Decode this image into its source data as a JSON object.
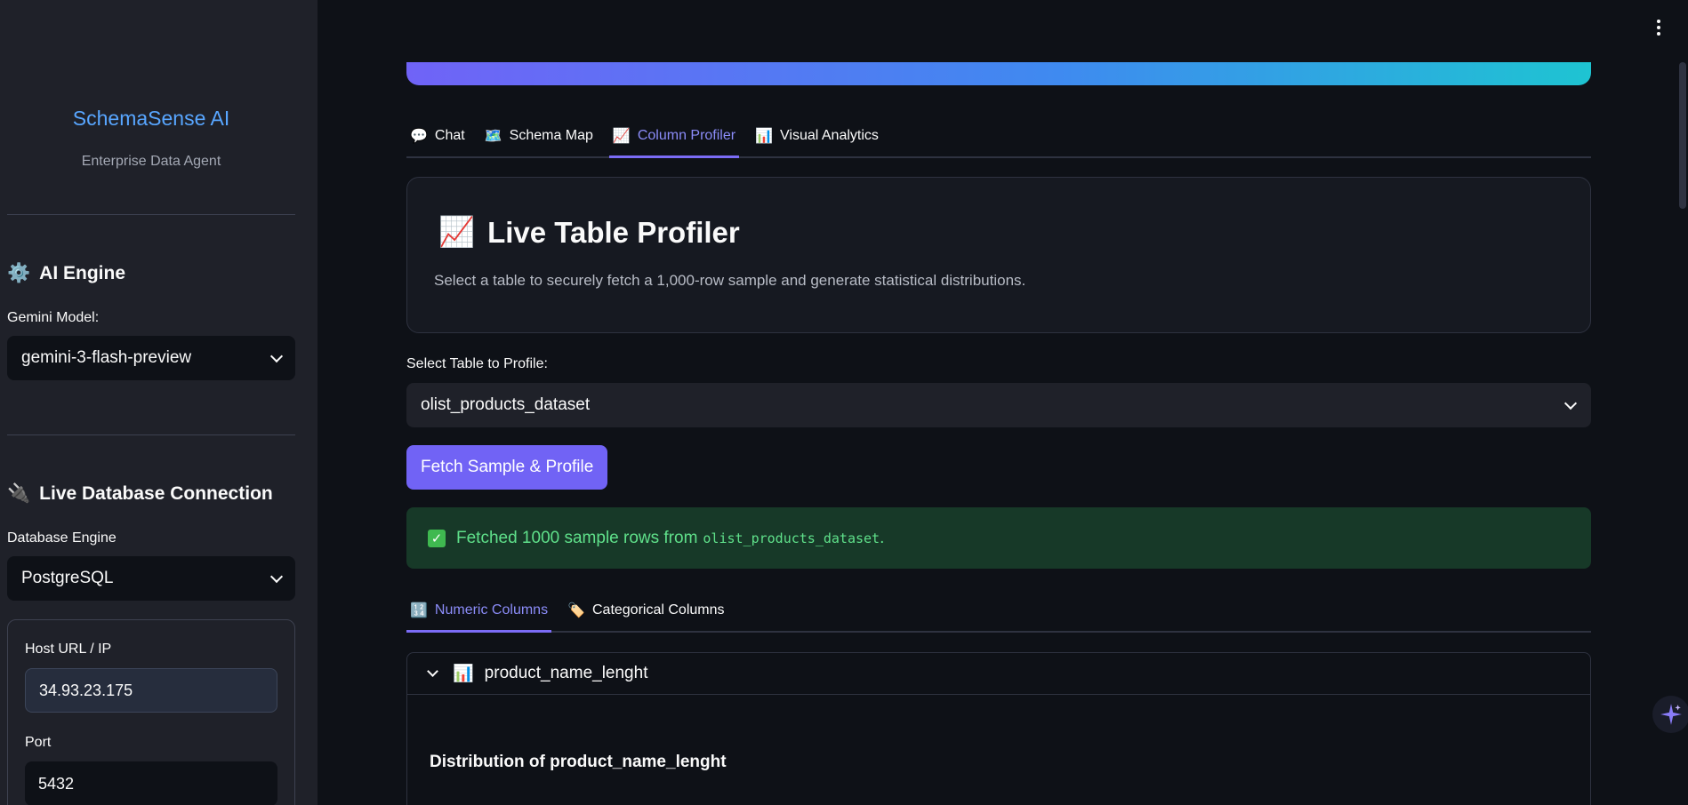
{
  "sidebar": {
    "brand_title": "SchemaSense AI",
    "brand_subtitle": "Enterprise Data Agent",
    "ai_engine": {
      "heading": "AI Engine",
      "model_label": "Gemini Model:",
      "model_value": "gemini-3-flash-preview"
    },
    "db": {
      "heading": "Live Database Connection",
      "engine_label": "Database Engine",
      "engine_value": "PostgreSQL",
      "host_label": "Host URL / IP",
      "host_value": "34.93.23.175",
      "port_label": "Port",
      "port_value": "5432"
    }
  },
  "main": {
    "tabs": [
      {
        "icon": "💬",
        "label": "Chat"
      },
      {
        "icon": "🗺️",
        "label": "Schema Map"
      },
      {
        "icon": "📈",
        "label": "Column Profiler",
        "active": true
      },
      {
        "icon": "📊",
        "label": "Visual Analytics"
      }
    ],
    "card": {
      "icon": "📈",
      "title": "Live Table Profiler",
      "description": "Select a table to securely fetch a 1,000-row sample and generate statistical distributions."
    },
    "select_label": "Select Table to Profile:",
    "select_value": "olist_products_dataset",
    "button_label": "Fetch Sample & Profile",
    "success": {
      "text": "Fetched 1000 sample rows from",
      "table": "olist_products_dataset",
      "suffix": "."
    },
    "subtabs": [
      {
        "icon": "🔢",
        "label": "Numeric Columns",
        "active": true
      },
      {
        "icon": "🏷️",
        "label": "Categorical Columns"
      }
    ],
    "expander": {
      "icon": "📊",
      "title": "product_name_lenght",
      "distribution_title": "Distribution of product_name_lenght"
    }
  },
  "colors": {
    "accent": "#7163f5",
    "brand": "#58a6ff",
    "success_bg": "#173928",
    "success_text": "#5fe08a"
  }
}
